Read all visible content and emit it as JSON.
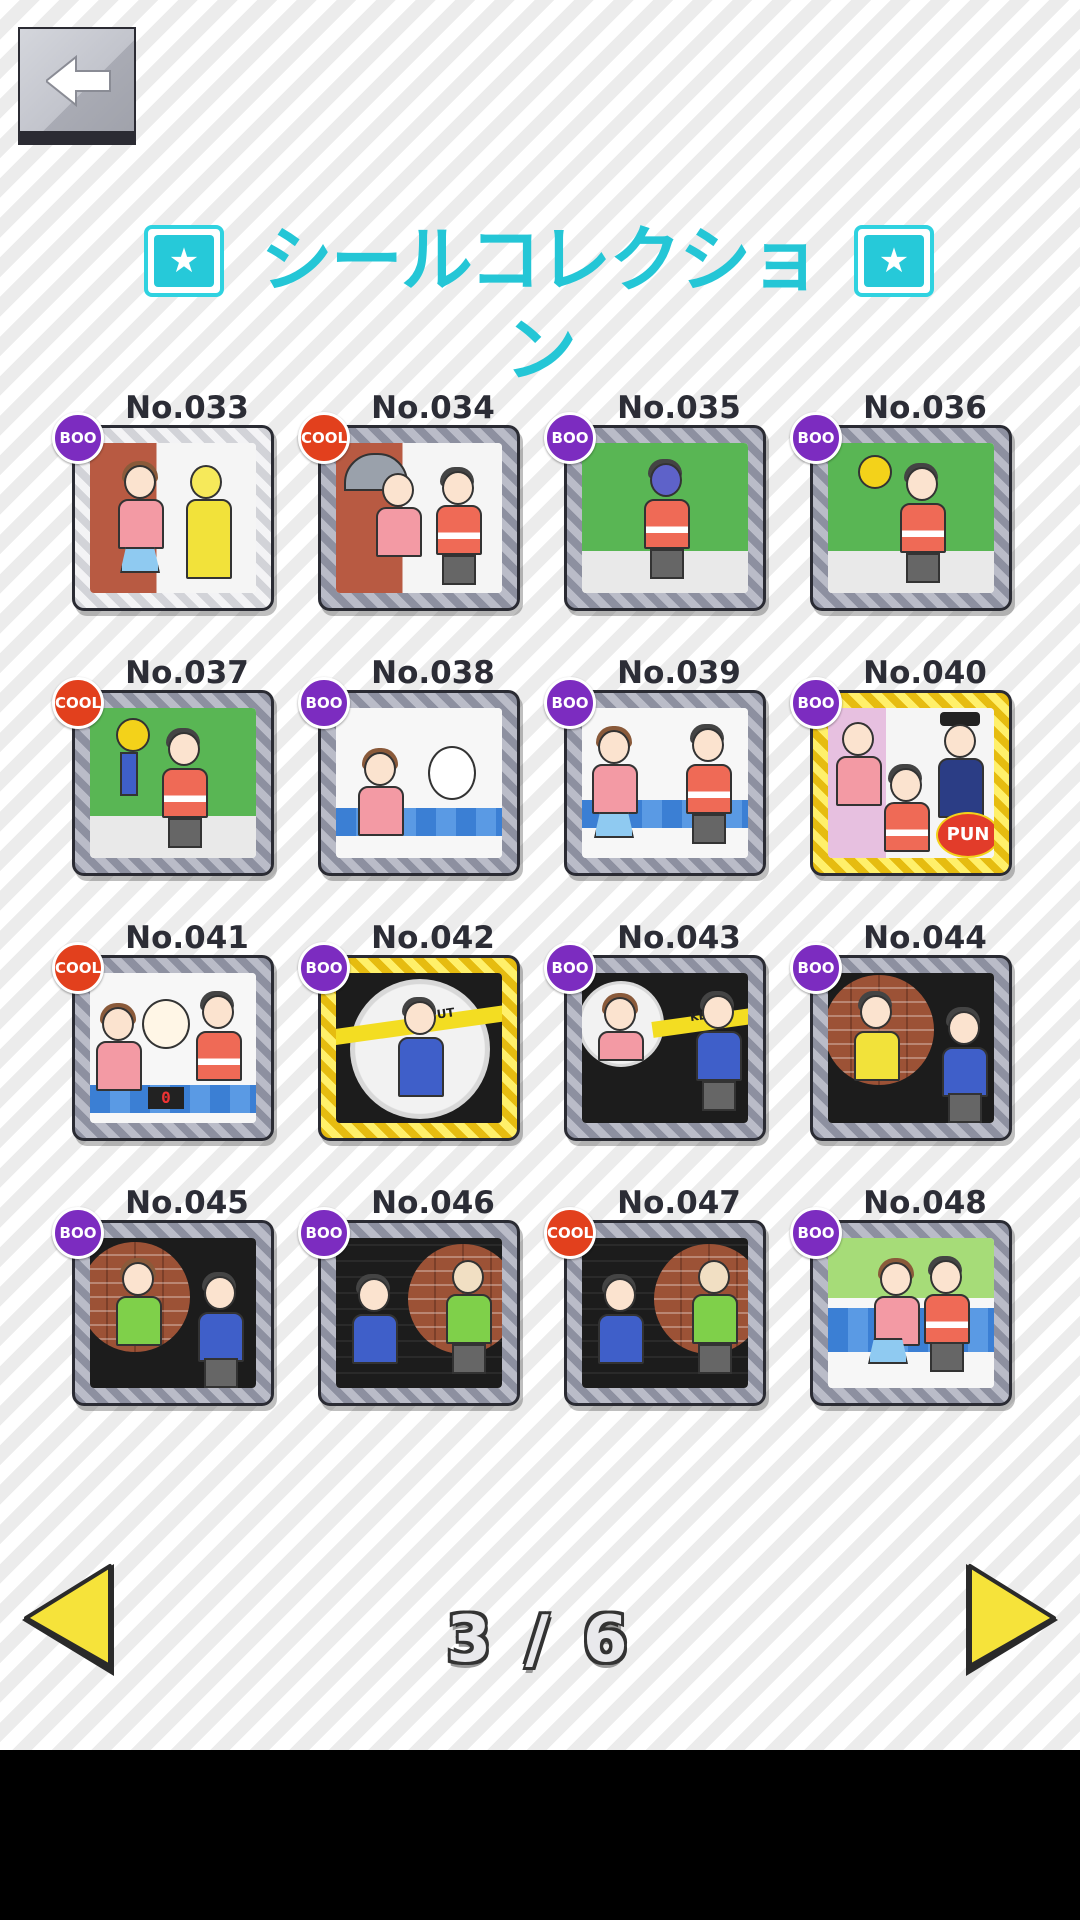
{
  "header": {
    "back_icon": "back-arrow-icon",
    "title": "シールコレクション",
    "title_color": "#24c6d6",
    "star_icon": "star-icon"
  },
  "stickers": [
    {
      "number": "No.033",
      "badge": "BOO",
      "frame": "silver"
    },
    {
      "number": "No.034",
      "badge": "COOL",
      "frame": "gray"
    },
    {
      "number": "No.035",
      "badge": "BOO",
      "frame": "gray"
    },
    {
      "number": "No.036",
      "badge": "BOO",
      "frame": "gray"
    },
    {
      "number": "No.037",
      "badge": "COOL",
      "frame": "gray"
    },
    {
      "number": "No.038",
      "badge": "BOO",
      "frame": "gray"
    },
    {
      "number": "No.039",
      "badge": "BOO",
      "frame": "gray"
    },
    {
      "number": "No.040",
      "badge": "BOO",
      "frame": "gold",
      "sign": "PUN"
    },
    {
      "number": "No.041",
      "badge": "COOL",
      "frame": "gray",
      "display": "0"
    },
    {
      "number": "No.042",
      "badge": "BOO",
      "frame": "gold",
      "tape": "PUT"
    },
    {
      "number": "No.043",
      "badge": "BOO",
      "frame": "gray",
      "tape": "KEEP"
    },
    {
      "number": "No.044",
      "badge": "BOO",
      "frame": "gray"
    },
    {
      "number": "No.045",
      "badge": "BOO",
      "frame": "gray"
    },
    {
      "number": "No.046",
      "badge": "BOO",
      "frame": "gray"
    },
    {
      "number": "No.047",
      "badge": "COOL",
      "frame": "gray"
    },
    {
      "number": "No.048",
      "badge": "BOO",
      "frame": "gray"
    }
  ],
  "pagination": {
    "current": "3",
    "separator": "/",
    "total": "6",
    "prev_icon": "triangle-left-icon",
    "next_icon": "triangle-right-icon",
    "arrow_color": "#f6e33a"
  },
  "colors": {
    "badge_boo": "#7c2cc0",
    "badge_cool": "#e2401d",
    "frame_gray": "#8d90a0",
    "frame_gold": "#e6bc10",
    "frame_silver": "#d2d3d8"
  }
}
